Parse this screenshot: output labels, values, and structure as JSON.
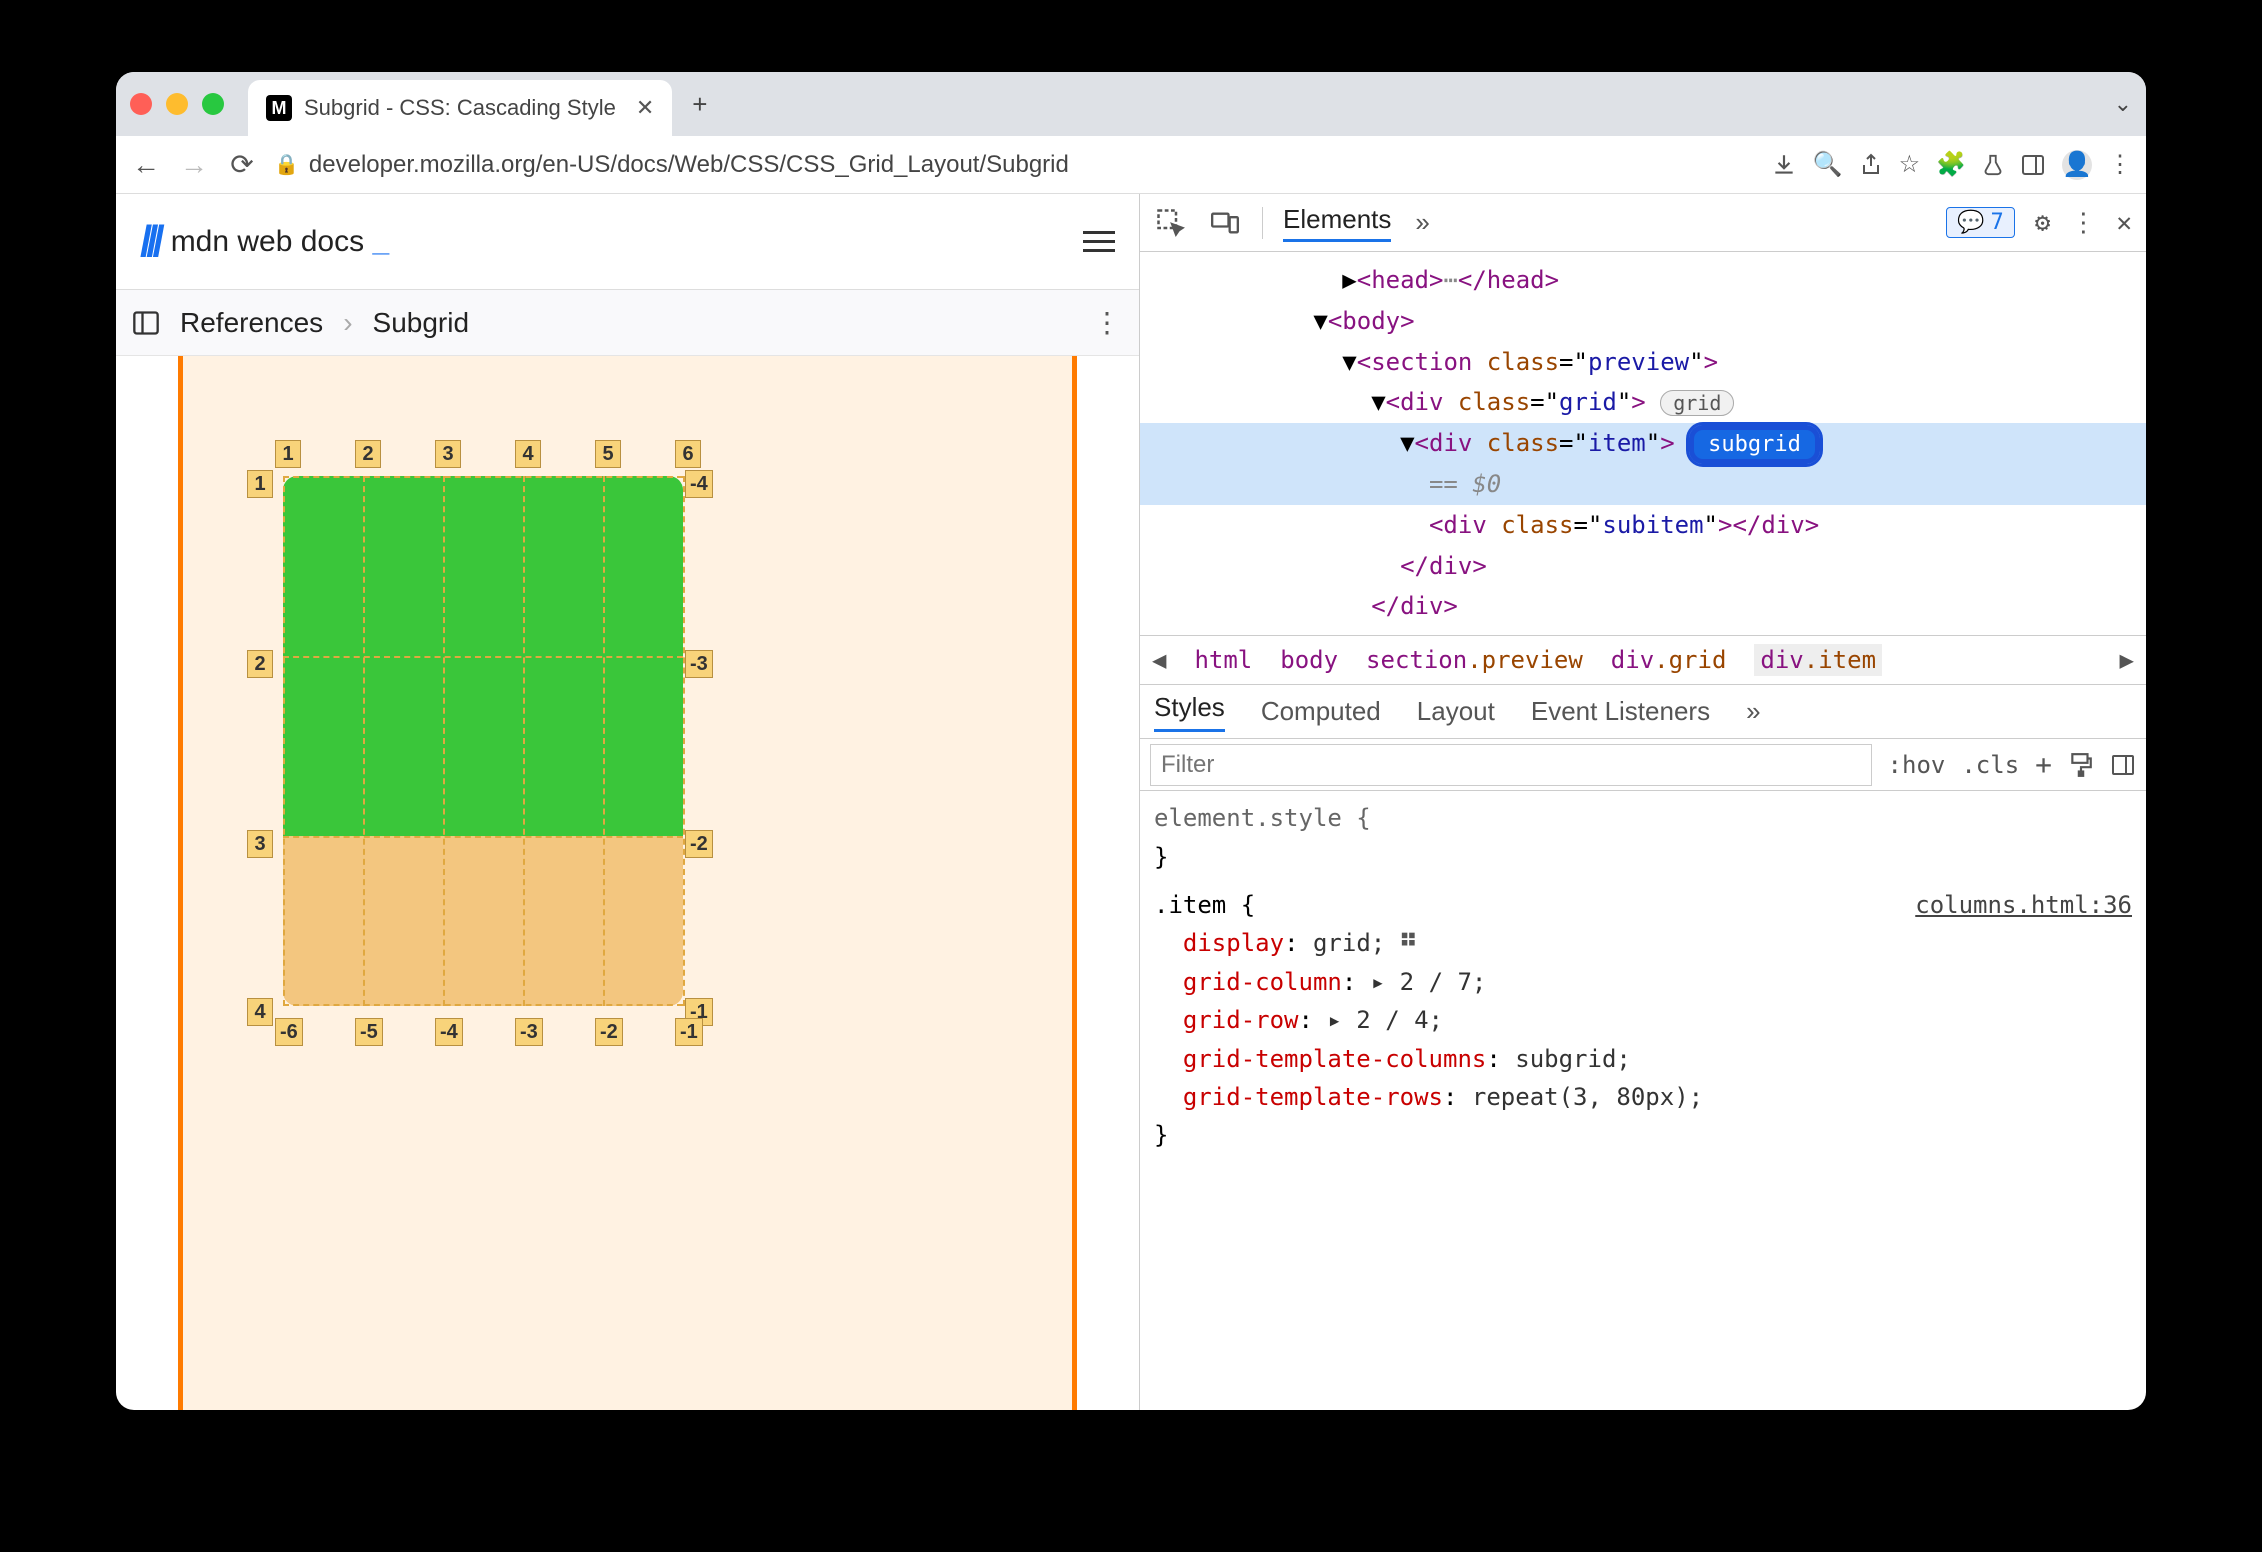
{
  "tab": {
    "title": "Subgrid - CSS: Cascading Style"
  },
  "url_display": "developer.mozilla.org/en-US/docs/Web/CSS/CSS_Grid_Layout/Subgrid",
  "mdn": {
    "brand_text": "mdn web docs",
    "cursor": "_"
  },
  "breadcrumb": {
    "root": "References",
    "current": "Subgrid"
  },
  "grid_labels": {
    "top": [
      "1",
      "2",
      "3",
      "4",
      "5",
      "6"
    ],
    "left": [
      "1",
      "2",
      "3",
      "4"
    ],
    "right": [
      "-4",
      "-3",
      "-2",
      "-1"
    ],
    "bottom": [
      "-6",
      "-5",
      "-4",
      "-3",
      "-2",
      "-1"
    ]
  },
  "devtools": {
    "panel": "Elements",
    "issues": "7",
    "dom": {
      "head_open": "<head>",
      "head_close": "</head>",
      "body": "<body>",
      "section": "<section class=\"preview\">",
      "grid": "<div class=\"grid\">",
      "grid_badge": "grid",
      "item": "<div class=\"item\">",
      "sub_badge": "subgrid",
      "eq": "== $0",
      "subitem": "<div class=\"subitem\"></div>",
      "div_close1": "</div>",
      "div_close2": "</div>"
    },
    "crumb": [
      "html",
      "body",
      "section.preview",
      "div.grid",
      "div.item"
    ],
    "style_tabs": [
      "Styles",
      "Computed",
      "Layout",
      "Event Listeners"
    ],
    "filter_placeholder": "Filter",
    "hov": ":hov",
    "cls": ".cls",
    "styles": {
      "elstyle": "element.style {",
      "close": "}",
      "selector": ".item {",
      "source": "columns.html:36",
      "rules": [
        {
          "p": "display",
          "v": "grid;"
        },
        {
          "p": "grid-column",
          "v": "▸ 2 / 7;"
        },
        {
          "p": "grid-row",
          "v": "▸ 2 / 4;"
        },
        {
          "p": "grid-template-columns",
          "v": "subgrid;"
        },
        {
          "p": "grid-template-rows",
          "v": "repeat(3, 80px);"
        }
      ]
    }
  }
}
